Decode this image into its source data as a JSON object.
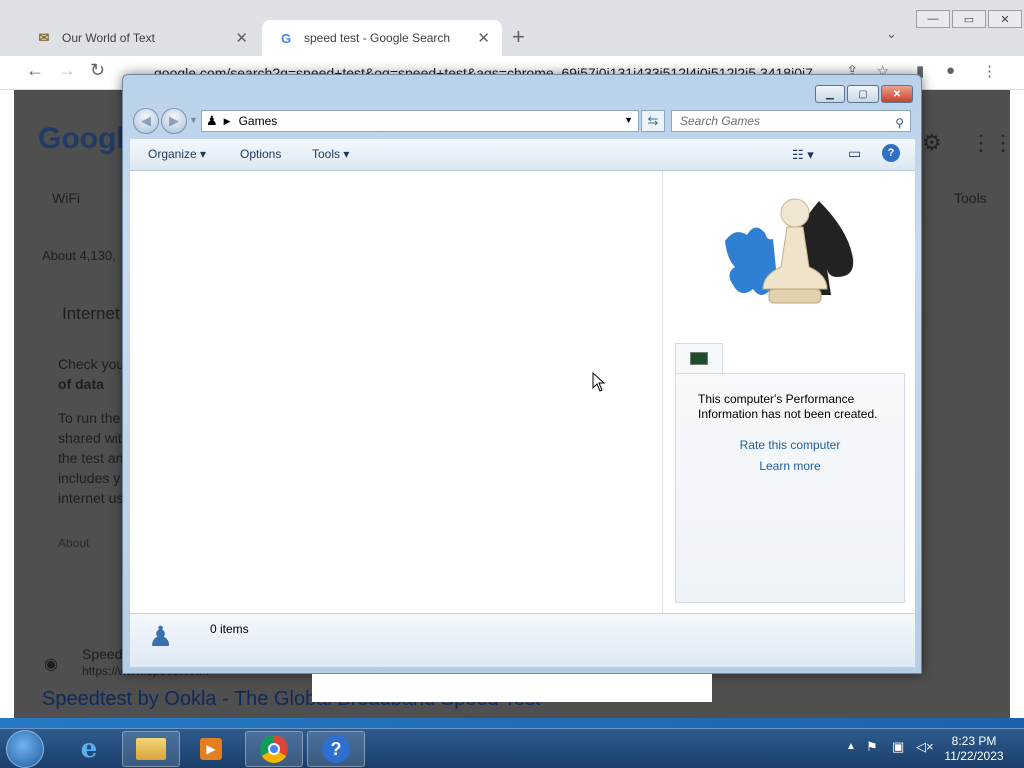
{
  "chrome": {
    "tabs": [
      {
        "title": "Our World of Text",
        "active": false
      },
      {
        "title": "speed test - Google Search",
        "active": true
      }
    ],
    "url": "google.com/search?q=speed+test&oq=speed+test&aqs=chrome..69i57j0i131i433i512l4j0i512l2j5.3418j0j7"
  },
  "background_page": {
    "logo": "Google",
    "tab_wifi": "WiFi",
    "tools": "Tools",
    "result_count": "About 4,130,",
    "heading": "Internet",
    "line1": "Check you",
    "line1b": "of data",
    "line2": "To run the",
    "line3": "shared wit",
    "line4": "the test an",
    "line5": "includes y",
    "line6": "internet us",
    "about": "About",
    "speed_site": "Speed",
    "speed_url": "https://www.speedtest.n",
    "footer_title": "Speedtest by Ookla - The Global Broadband Speed Test"
  },
  "explorer": {
    "address": "Games",
    "search_placeholder": "Search Games",
    "commands": {
      "organize": "Organize",
      "options": "Options",
      "tools": "Tools"
    },
    "perf_text": "This computer's Performance Information has not been created.",
    "rate_link": "Rate this computer",
    "learn_link": "Learn more",
    "item_count": "0 items"
  },
  "taskbar": {
    "time": "8:23 PM",
    "date": "11/22/2023"
  }
}
